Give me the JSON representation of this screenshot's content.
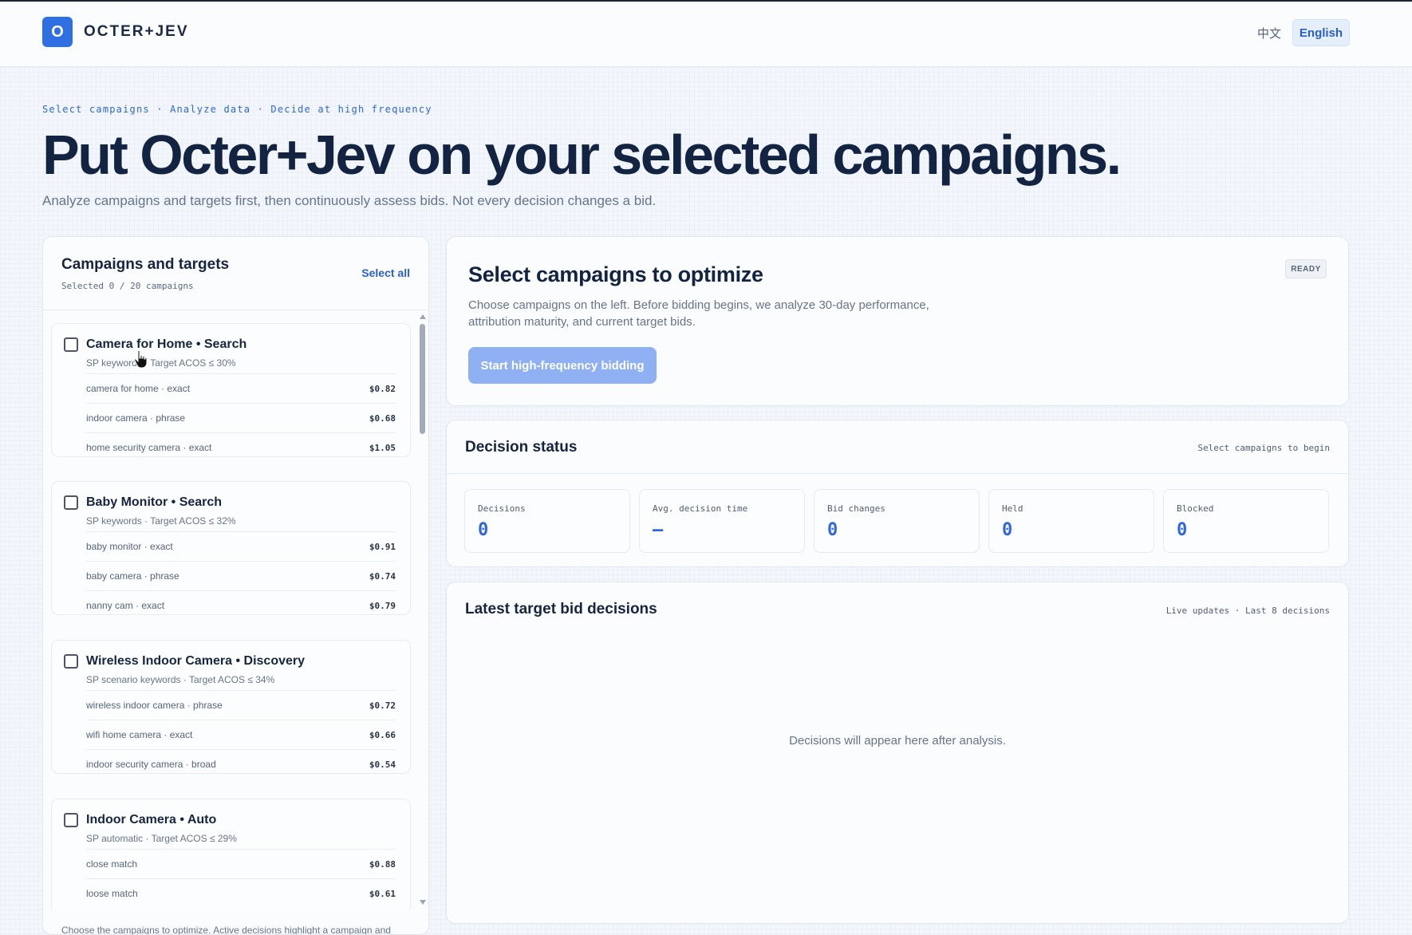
{
  "header": {
    "logo_letter": "O",
    "brand": "OCTER+JEV",
    "lang_zh": "中文",
    "lang_en": "English"
  },
  "hero": {
    "eyebrow": "Select campaigns · Analyze data · Decide at high frequency",
    "title": "Put Octer+Jev on your selected campaigns.",
    "subtitle": "Analyze campaigns and targets first, then continuously assess bids. Not every decision changes a bid."
  },
  "campaigns_panel": {
    "title": "Campaigns and targets",
    "selected_count": "Selected 0 / 20 campaigns",
    "select_all": "Select all",
    "footer": "Choose the campaigns to optimize. Active decisions highlight a campaign and",
    "campaigns": [
      {
        "title": "Camera for Home • Search",
        "meta": "SP keywords · Target ACOS ≤ 30%",
        "targets": [
          {
            "name": "camera for home · exact",
            "bid": "$0.82"
          },
          {
            "name": "indoor camera · phrase",
            "bid": "$0.68"
          },
          {
            "name": "home security camera · exact",
            "bid": "$1.05"
          }
        ]
      },
      {
        "title": "Baby Monitor • Search",
        "meta": "SP keywords · Target ACOS ≤ 32%",
        "targets": [
          {
            "name": "baby monitor · exact",
            "bid": "$0.91"
          },
          {
            "name": "baby camera · phrase",
            "bid": "$0.74"
          },
          {
            "name": "nanny cam · exact",
            "bid": "$0.79"
          }
        ]
      },
      {
        "title": "Wireless Indoor Camera • Discovery",
        "meta": "SP scenario keywords · Target ACOS ≤ 34%",
        "targets": [
          {
            "name": "wireless indoor camera · phrase",
            "bid": "$0.72"
          },
          {
            "name": "wifi home camera · exact",
            "bid": "$0.66"
          },
          {
            "name": "indoor security camera · broad",
            "bid": "$0.54"
          }
        ]
      },
      {
        "title": "Indoor Camera • Auto",
        "meta": "SP automatic · Target ACOS ≤ 29%",
        "targets": [
          {
            "name": "close match",
            "bid": "$0.88"
          },
          {
            "name": "loose match",
            "bid": "$0.61"
          }
        ]
      }
    ]
  },
  "optimize_card": {
    "title": "Select campaigns to optimize",
    "description": "Choose campaigns on the left. Before bidding begins, we analyze 30-day performance, attribution maturity, and current target bids.",
    "button": "Start high-frequency bidding",
    "badge": "READY"
  },
  "status_card": {
    "title": "Decision status",
    "hint": "Select campaigns to begin",
    "metrics": [
      {
        "label": "Decisions",
        "value": "0"
      },
      {
        "label": "Avg. decision time",
        "value": "—"
      },
      {
        "label": "Bid changes",
        "value": "0"
      },
      {
        "label": "Held",
        "value": "0"
      },
      {
        "label": "Blocked",
        "value": "0"
      }
    ]
  },
  "decisions_card": {
    "title": "Latest target bid decisions",
    "hint": "Live updates · Last 8 decisions",
    "empty": "Decisions will appear here after analysis."
  }
}
